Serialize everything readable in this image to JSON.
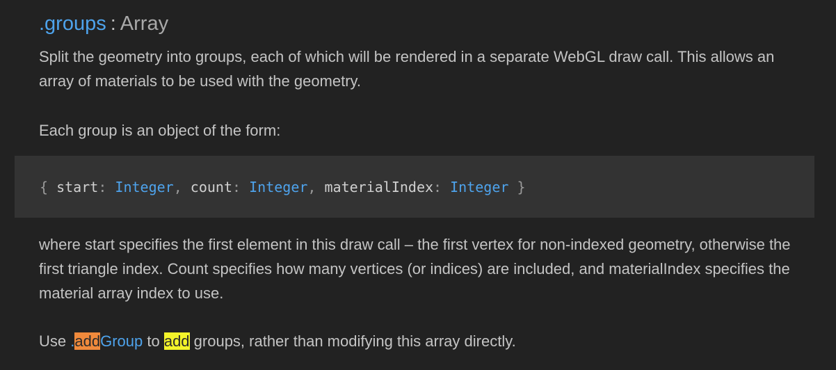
{
  "heading": {
    "property": ".groups",
    "separator": ":",
    "type": "Array"
  },
  "paragraphs": {
    "intro": "Split the geometry into groups, each of which will be rendered in a separate WebGL draw call. This allows an array of materials to be used with the geometry.",
    "form_intro": "Each group is an object of the form:",
    "explanation": "where start specifies the first element in this draw call – the first vertex for non-indexed geometry, otherwise the first triangle index. Count specifies how many vertices (or indices) are included, and materialIndex specifies the material array index to use."
  },
  "code": {
    "open_brace": "{",
    "key1": "start",
    "type1": "Integer",
    "key2": "count",
    "type2": "Integer",
    "key3": "materialIndex",
    "type3": "Integer",
    "close_brace": "}"
  },
  "usage": {
    "prefix": "Use ",
    "link_dot": ".",
    "link_highlight": "add",
    "link_rest": "Group",
    "to": " to ",
    "highlight_word": "add",
    "suffix": " groups, rather than modifying this array directly."
  },
  "colors": {
    "background": "#222222",
    "code_background": "#333333",
    "accent": "#4ea3ec",
    "highlight_orange": "#f08a3c",
    "highlight_yellow": "#f3f32a"
  }
}
